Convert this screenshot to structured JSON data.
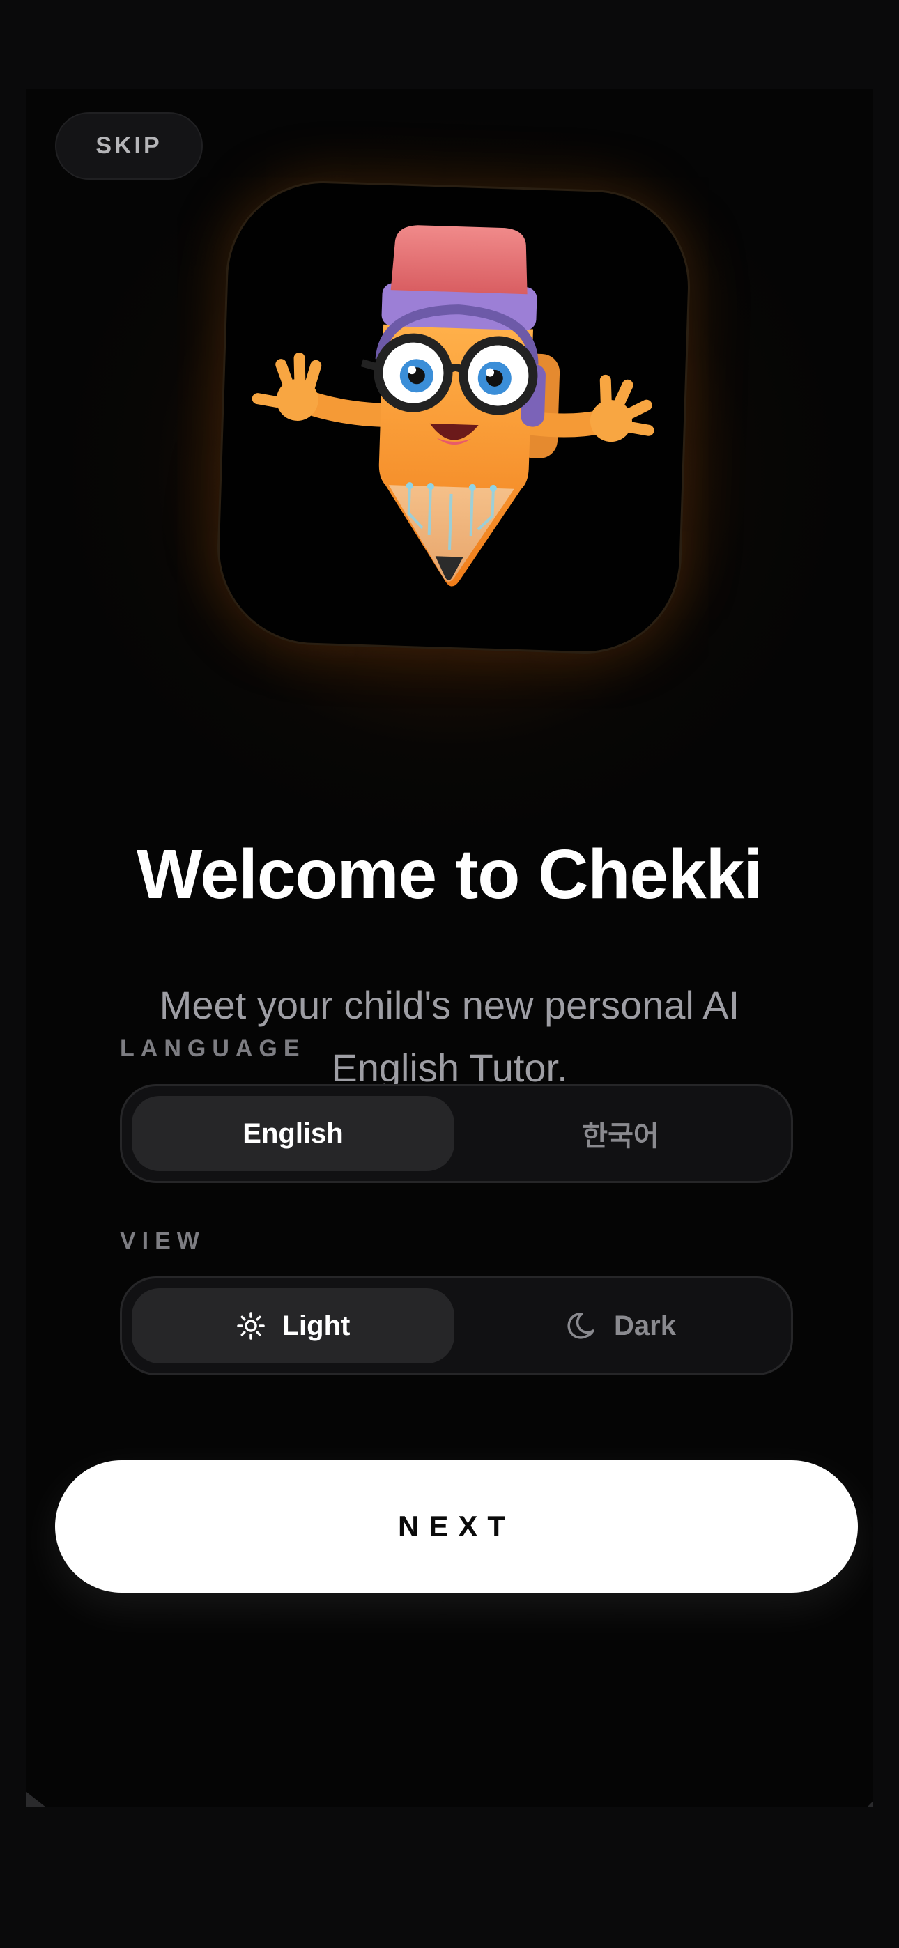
{
  "header": {
    "skip_label": "SKIP"
  },
  "hero": {
    "mascot": "pencil-mascot-illustration"
  },
  "welcome": {
    "title": "Welcome to Chekki",
    "subtitle": "Meet your child's new personal AI English Tutor."
  },
  "language": {
    "label": "LANGUAGE",
    "options": [
      "English",
      "한국어"
    ],
    "selected": "English"
  },
  "view": {
    "label": "VIEW",
    "options": [
      {
        "label": "Light",
        "icon": "sun-icon"
      },
      {
        "label": "Dark",
        "icon": "moon-icon"
      }
    ],
    "selected": "Light"
  },
  "footer": {
    "next_label": "NEXT"
  },
  "colors": {
    "background": "#050505",
    "accent_glow": "#aa500a",
    "button_primary": "#ffffff",
    "segment_active": "#262628"
  }
}
